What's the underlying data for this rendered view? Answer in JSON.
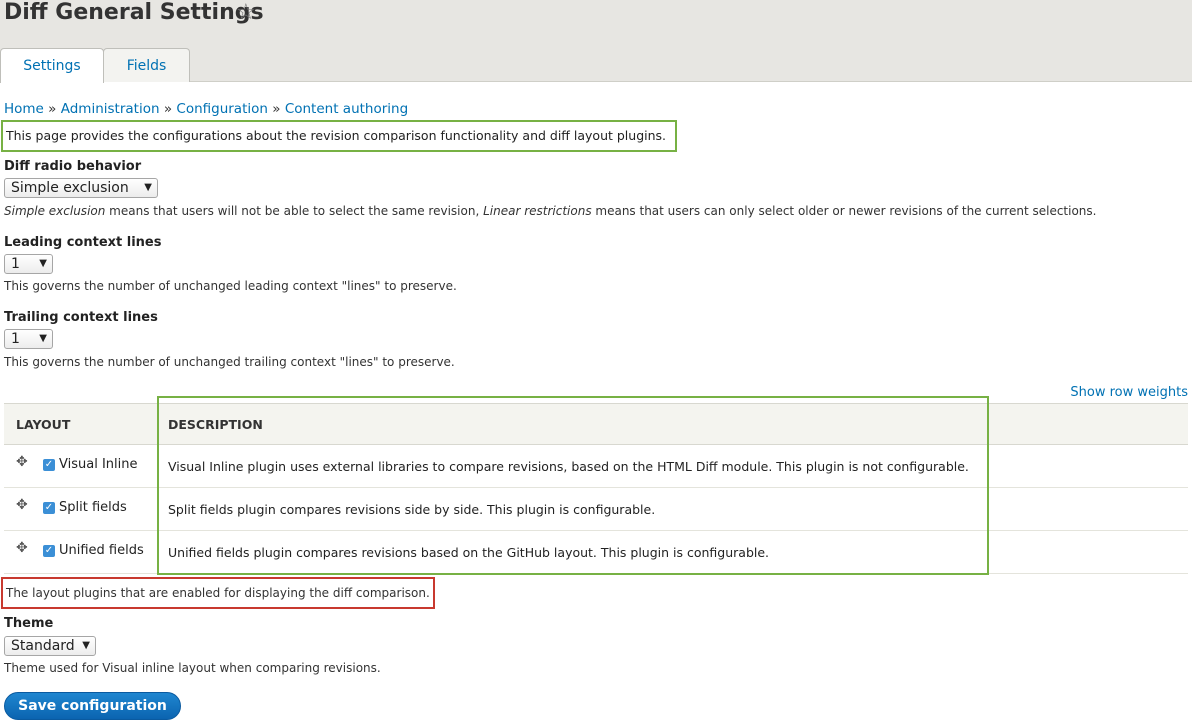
{
  "header": {
    "title": "Diff General Settings",
    "star_icon": "☆",
    "tabs": [
      {
        "label": "Settings"
      },
      {
        "label": "Fields"
      }
    ]
  },
  "breadcrumb": [
    {
      "label": "Home"
    },
    {
      "label": "Administration"
    },
    {
      "label": "Configuration"
    },
    {
      "label": "Content authoring"
    }
  ],
  "breadcrumb_separator": "»",
  "intro": "This page provides the configurations about the revision comparison functionality and diff layout plugins.",
  "radio_behavior": {
    "label": "Diff radio behavior",
    "value": "Simple exclusion",
    "help_em1": "Simple exclusion",
    "help_part1": " means that users will not be able to select the same revision, ",
    "help_em2": "Linear restrictions",
    "help_part2": " means that users can only select older or newer revisions of the current selections."
  },
  "leading": {
    "label": "Leading context lines",
    "value": "1",
    "help": "This governs the number of unchanged leading context \"lines\" to preserve."
  },
  "trailing": {
    "label": "Trailing context lines",
    "value": "1",
    "help": "This governs the number of unchanged trailing context \"lines\" to preserve."
  },
  "table": {
    "show_weights": "Show row weights",
    "col_layout": "LAYOUT",
    "col_description": "DESCRIPTION",
    "rows": [
      {
        "name": "Visual Inline",
        "checked": true,
        "description": "Visual Inline plugin uses external libraries to compare revisions, based on the HTML Diff module. This plugin is not configurable."
      },
      {
        "name": "Split fields",
        "checked": true,
        "description": "Split fields plugin compares revisions side by side. This plugin is configurable."
      },
      {
        "name": "Unified fields",
        "checked": true,
        "description": "Unified fields plugin compares revisions based on the GitHub layout. This plugin is configurable."
      }
    ],
    "help": "The layout plugins that are enabled for displaying the diff comparison."
  },
  "theme": {
    "label": "Theme",
    "value": "Standard",
    "help": "Theme used for Visual inline layout when comparing revisions."
  },
  "save_label": "Save configuration",
  "colors": {
    "link": "#0071b3",
    "highlight_green": "#77b144",
    "highlight_red": "#c8392f",
    "button": "#0b64b0"
  },
  "icons": {
    "drag": "drag-handle-icon",
    "checkbox": "checkbox-checked-icon",
    "dropdown": "chevron-down-icon"
  }
}
